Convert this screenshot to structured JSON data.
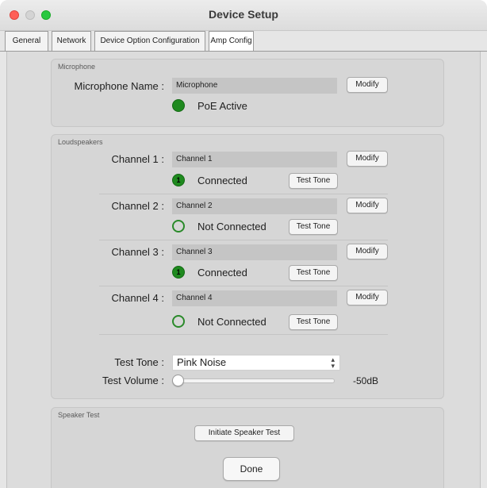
{
  "window": {
    "title": "Device Setup"
  },
  "tabs": [
    {
      "label": "General"
    },
    {
      "label": "Network"
    },
    {
      "label": "Device Option Configuration"
    },
    {
      "label": "Amp Config",
      "active": true
    }
  ],
  "microphone": {
    "group_title": "Microphone",
    "name_label": "Microphone Name :",
    "name_value": "Microphone",
    "modify_label": "Modify",
    "status": "PoE Active"
  },
  "loudspeakers": {
    "group_title": "Loudspeakers",
    "channels": [
      {
        "label": "Channel 1 :",
        "value": "Channel 1",
        "modify_label": "Modify",
        "indicator": "1",
        "status": "Connected",
        "test_tone_label": "Test Tone"
      },
      {
        "label": "Channel 2 :",
        "value": "Channel 2",
        "modify_label": "Modify",
        "indicator": "",
        "status": "Not Connected",
        "test_tone_label": "Test Tone"
      },
      {
        "label": "Channel 3 :",
        "value": "Channel 3",
        "modify_label": "Modify",
        "indicator": "1",
        "status": "Connected",
        "test_tone_label": "Test Tone"
      },
      {
        "label": "Channel 4 :",
        "value": "Channel 4",
        "modify_label": "Modify",
        "indicator": "",
        "status": "Not Connected",
        "test_tone_label": "Test Tone"
      }
    ],
    "test_tone_label": "Test Tone :",
    "test_tone_value": "Pink Noise",
    "test_volume_label": "Test Volume :",
    "test_volume_value": "-50dB",
    "test_volume_level": 0.0
  },
  "speaker_test": {
    "group_title": "Speaker Test",
    "button_label": "Initiate Speaker Test"
  },
  "footer": {
    "done_label": "Done"
  },
  "colors": {
    "status_green": "#1f8a1f",
    "close": "#ff5f57",
    "zoom": "#28c840"
  }
}
